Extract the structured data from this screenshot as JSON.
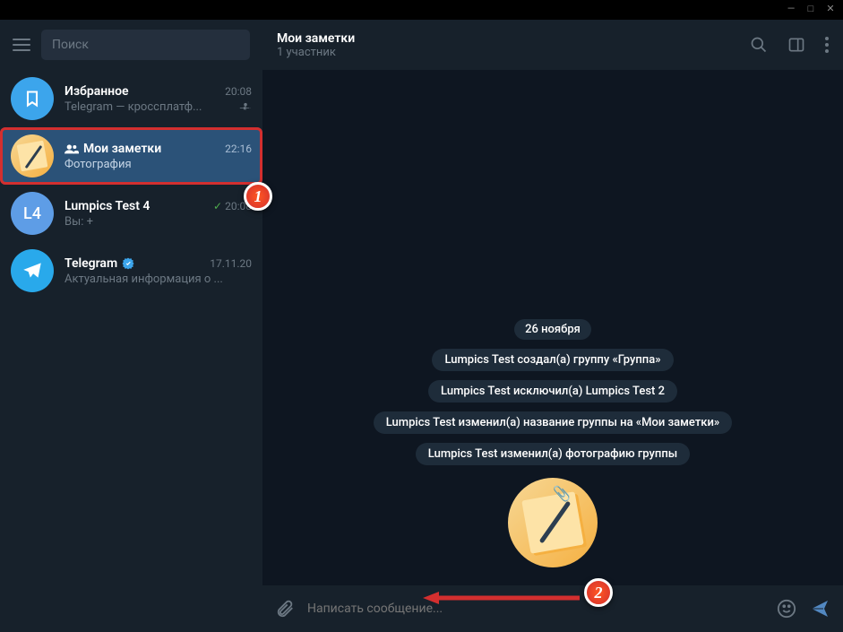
{
  "window": {
    "title": ""
  },
  "sidebar": {
    "search_placeholder": "Поиск",
    "chats": [
      {
        "name": "Избранное",
        "time": "20:08",
        "preview": "Telegram — кроссплатф...",
        "pinned": true
      },
      {
        "name": "Мои заметки",
        "time": "22:16",
        "preview": "Фотография",
        "group": true
      },
      {
        "name": "Lumpics Test 4",
        "time": "20:08",
        "preview": "Вы: +",
        "read": true
      },
      {
        "name": "Telegram",
        "time": "17.11.20",
        "preview": "Актуальная информация о ...",
        "verified": true
      }
    ],
    "avatar_l4": "L4"
  },
  "header": {
    "title": "Мои заметки",
    "subtitle": "1 участник"
  },
  "messages": {
    "date": "26 ноября",
    "services": [
      "Lumpics Test создал(а) группу «Группа»",
      "Lumpics Test исключил(а) Lumpics Test 2",
      "Lumpics Test изменил(а) название группы на «Мои заметки»",
      "Lumpics Test изменил(а) фотографию группы"
    ]
  },
  "input": {
    "placeholder": "Написать сообщение..."
  },
  "annotations": {
    "one": "1",
    "two": "2"
  }
}
